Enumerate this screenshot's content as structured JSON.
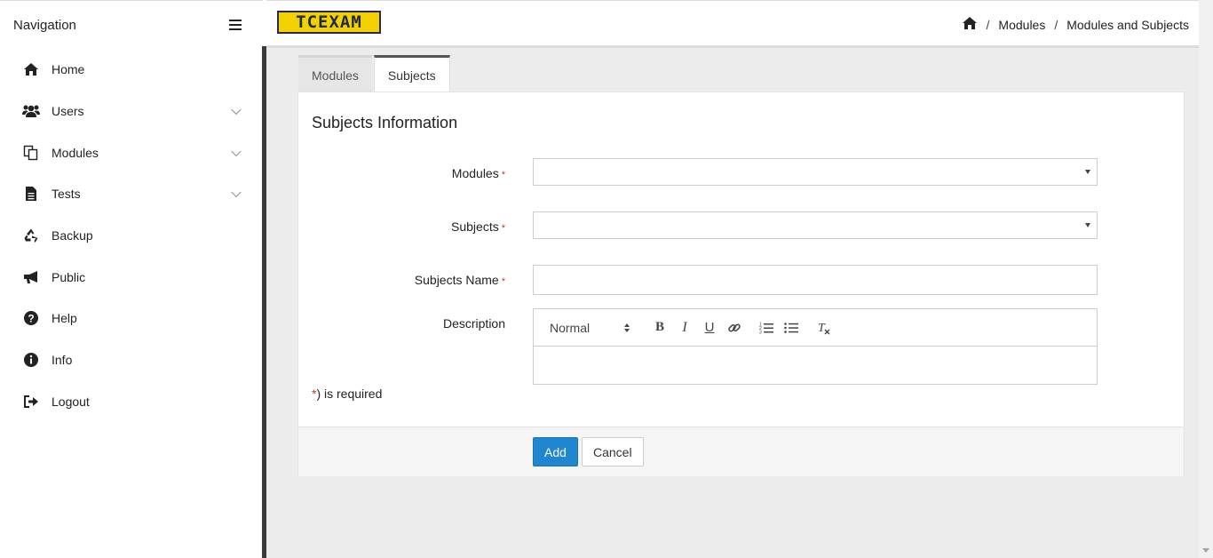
{
  "sidebar": {
    "title": "Navigation",
    "items": [
      {
        "label": "Home",
        "icon": "home-icon"
      },
      {
        "label": "Users",
        "icon": "users-icon",
        "expandable": true
      },
      {
        "label": "Modules",
        "icon": "copy-icon",
        "expandable": true
      },
      {
        "label": "Tests",
        "icon": "file-icon",
        "expandable": true
      },
      {
        "label": "Backup",
        "icon": "recycle-icon"
      },
      {
        "label": "Public",
        "icon": "bullhorn-icon"
      },
      {
        "label": "Help",
        "icon": "question-circle-icon"
      },
      {
        "label": "Info",
        "icon": "info-circle-icon"
      },
      {
        "label": "Logout",
        "icon": "sign-out-icon"
      }
    ]
  },
  "header": {
    "logo_text": "TCEXAM",
    "breadcrumb": [
      "Modules",
      "Modules and Subjects"
    ],
    "separator": "/"
  },
  "tabs": [
    {
      "label": "Modules",
      "active": false
    },
    {
      "label": "Subjects",
      "active": true
    }
  ],
  "form": {
    "title": "Subjects Information",
    "modules_label": "Modules",
    "modules_value": "",
    "subjects_label": "Subjects",
    "subjects_value": "",
    "subjects_name_label": "Subjects Name",
    "subjects_name_value": "",
    "description_label": "Description",
    "required_star": "*",
    "required_note": ") is required",
    "editor_format": "Normal"
  },
  "actions": {
    "add_label": "Add",
    "cancel_label": "Cancel"
  },
  "colors": {
    "accent": "#1f86cf",
    "logo_bg": "#f3d000",
    "sidebar_divider": "#3a3a3a",
    "required": "#c0392b"
  }
}
